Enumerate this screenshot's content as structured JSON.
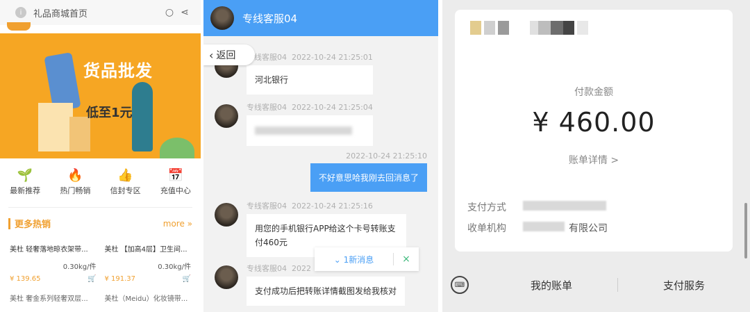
{
  "panel1": {
    "title": "礼品商城首页",
    "banner_title": "货品批发",
    "banner_tag": "低至1元/件",
    "categories": [
      {
        "icon": "leaf-icon",
        "glyph": "🌱",
        "label": "最新推荐"
      },
      {
        "icon": "fire-icon",
        "glyph": "🔥",
        "label": "热门畅销"
      },
      {
        "icon": "thumbs-up-icon",
        "glyph": "👍",
        "label": "信封专区"
      },
      {
        "icon": "calendar-icon",
        "glyph": "📅",
        "label": "充值中心"
      }
    ],
    "hot_label": "更多热销",
    "more_label": "more »",
    "goods": [
      {
        "name": "美杜 轻奢落地晾衣架带...",
        "weight": "0.30kg/件",
        "price": "¥ 139.65"
      },
      {
        "name": "美杜 【加高4层】卫生间...",
        "weight": "0.30kg/件",
        "price": "¥ 191.37"
      }
    ],
    "goods_next": [
      "美杜 奢金系列轻奢双层...",
      "美杜（Meidu）化妆镜带..."
    ]
  },
  "panel2": {
    "agent_name": "专线客服04",
    "back_label": "返回",
    "messages": [
      {
        "sender": "专线客服04",
        "time": "2022-10-24 21:25:01",
        "text": "河北银行"
      },
      {
        "sender": "专线客服04",
        "time": "2022-10-24 21:25:04",
        "text": ""
      },
      {
        "sender": "",
        "time": "2022-10-24 21:25:10",
        "text": "不好意思哈我刚去回消息了"
      },
      {
        "sender": "专线客服04",
        "time": "2022-10-24 21:25:16",
        "text": "用您的手机银行APP给这个卡号转账支付460元"
      },
      {
        "sender": "专线客服04",
        "time": "2022",
        "text": "支付成功后把转账详情截图发给我核对"
      }
    ],
    "new_msg": "1新消息"
  },
  "panel3": {
    "pay_label": "付款金额",
    "amount": "¥ 460.00",
    "detail_label": "账单详情 >",
    "method_label": "支付方式",
    "merchant_label": "收单机构",
    "merchant_value": "有限公司",
    "tab_bill": "我的账单",
    "tab_service": "支付服务"
  },
  "colors": {
    "accent_blue": "#4a9ff5",
    "accent_orange": "#f0a030"
  }
}
